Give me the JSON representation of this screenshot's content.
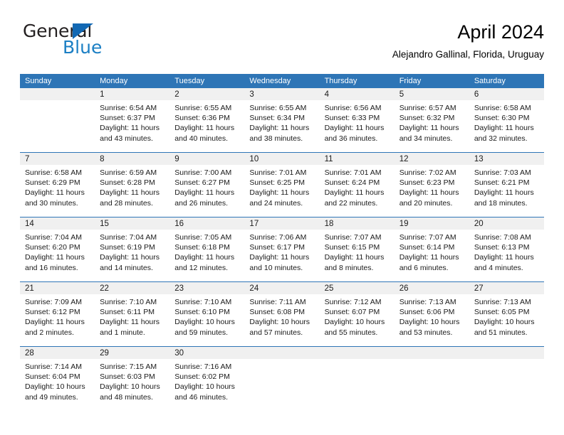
{
  "brand": {
    "name_dark": "General",
    "name_blue": "Blue",
    "triangle_color": "#1268b3",
    "blue_color": "#1b7fc4"
  },
  "header": {
    "title": "April 2024",
    "subtitle": "Alejandro Gallinal, Florida, Uruguay"
  },
  "theme": {
    "header_blue": "#2e75b6",
    "day_band_gray": "#f0f0f0",
    "text": "#1a1a1a"
  },
  "weekdays": [
    "Sunday",
    "Monday",
    "Tuesday",
    "Wednesday",
    "Thursday",
    "Friday",
    "Saturday"
  ],
  "weeks": [
    [
      {
        "day": "",
        "sunrise": "",
        "sunset": "",
        "daylight1": "",
        "daylight2": ""
      },
      {
        "day": "1",
        "sunrise": "Sunrise: 6:54 AM",
        "sunset": "Sunset: 6:37 PM",
        "daylight1": "Daylight: 11 hours",
        "daylight2": "and 43 minutes."
      },
      {
        "day": "2",
        "sunrise": "Sunrise: 6:55 AM",
        "sunset": "Sunset: 6:36 PM",
        "daylight1": "Daylight: 11 hours",
        "daylight2": "and 40 minutes."
      },
      {
        "day": "3",
        "sunrise": "Sunrise: 6:55 AM",
        "sunset": "Sunset: 6:34 PM",
        "daylight1": "Daylight: 11 hours",
        "daylight2": "and 38 minutes."
      },
      {
        "day": "4",
        "sunrise": "Sunrise: 6:56 AM",
        "sunset": "Sunset: 6:33 PM",
        "daylight1": "Daylight: 11 hours",
        "daylight2": "and 36 minutes."
      },
      {
        "day": "5",
        "sunrise": "Sunrise: 6:57 AM",
        "sunset": "Sunset: 6:32 PM",
        "daylight1": "Daylight: 11 hours",
        "daylight2": "and 34 minutes."
      },
      {
        "day": "6",
        "sunrise": "Sunrise: 6:58 AM",
        "sunset": "Sunset: 6:30 PM",
        "daylight1": "Daylight: 11 hours",
        "daylight2": "and 32 minutes."
      }
    ],
    [
      {
        "day": "7",
        "sunrise": "Sunrise: 6:58 AM",
        "sunset": "Sunset: 6:29 PM",
        "daylight1": "Daylight: 11 hours",
        "daylight2": "and 30 minutes."
      },
      {
        "day": "8",
        "sunrise": "Sunrise: 6:59 AM",
        "sunset": "Sunset: 6:28 PM",
        "daylight1": "Daylight: 11 hours",
        "daylight2": "and 28 minutes."
      },
      {
        "day": "9",
        "sunrise": "Sunrise: 7:00 AM",
        "sunset": "Sunset: 6:27 PM",
        "daylight1": "Daylight: 11 hours",
        "daylight2": "and 26 minutes."
      },
      {
        "day": "10",
        "sunrise": "Sunrise: 7:01 AM",
        "sunset": "Sunset: 6:25 PM",
        "daylight1": "Daylight: 11 hours",
        "daylight2": "and 24 minutes."
      },
      {
        "day": "11",
        "sunrise": "Sunrise: 7:01 AM",
        "sunset": "Sunset: 6:24 PM",
        "daylight1": "Daylight: 11 hours",
        "daylight2": "and 22 minutes."
      },
      {
        "day": "12",
        "sunrise": "Sunrise: 7:02 AM",
        "sunset": "Sunset: 6:23 PM",
        "daylight1": "Daylight: 11 hours",
        "daylight2": "and 20 minutes."
      },
      {
        "day": "13",
        "sunrise": "Sunrise: 7:03 AM",
        "sunset": "Sunset: 6:21 PM",
        "daylight1": "Daylight: 11 hours",
        "daylight2": "and 18 minutes."
      }
    ],
    [
      {
        "day": "14",
        "sunrise": "Sunrise: 7:04 AM",
        "sunset": "Sunset: 6:20 PM",
        "daylight1": "Daylight: 11 hours",
        "daylight2": "and 16 minutes."
      },
      {
        "day": "15",
        "sunrise": "Sunrise: 7:04 AM",
        "sunset": "Sunset: 6:19 PM",
        "daylight1": "Daylight: 11 hours",
        "daylight2": "and 14 minutes."
      },
      {
        "day": "16",
        "sunrise": "Sunrise: 7:05 AM",
        "sunset": "Sunset: 6:18 PM",
        "daylight1": "Daylight: 11 hours",
        "daylight2": "and 12 minutes."
      },
      {
        "day": "17",
        "sunrise": "Sunrise: 7:06 AM",
        "sunset": "Sunset: 6:17 PM",
        "daylight1": "Daylight: 11 hours",
        "daylight2": "and 10 minutes."
      },
      {
        "day": "18",
        "sunrise": "Sunrise: 7:07 AM",
        "sunset": "Sunset: 6:15 PM",
        "daylight1": "Daylight: 11 hours",
        "daylight2": "and 8 minutes."
      },
      {
        "day": "19",
        "sunrise": "Sunrise: 7:07 AM",
        "sunset": "Sunset: 6:14 PM",
        "daylight1": "Daylight: 11 hours",
        "daylight2": "and 6 minutes."
      },
      {
        "day": "20",
        "sunrise": "Sunrise: 7:08 AM",
        "sunset": "Sunset: 6:13 PM",
        "daylight1": "Daylight: 11 hours",
        "daylight2": "and 4 minutes."
      }
    ],
    [
      {
        "day": "21",
        "sunrise": "Sunrise: 7:09 AM",
        "sunset": "Sunset: 6:12 PM",
        "daylight1": "Daylight: 11 hours",
        "daylight2": "and 2 minutes."
      },
      {
        "day": "22",
        "sunrise": "Sunrise: 7:10 AM",
        "sunset": "Sunset: 6:11 PM",
        "daylight1": "Daylight: 11 hours",
        "daylight2": "and 1 minute."
      },
      {
        "day": "23",
        "sunrise": "Sunrise: 7:10 AM",
        "sunset": "Sunset: 6:10 PM",
        "daylight1": "Daylight: 10 hours",
        "daylight2": "and 59 minutes."
      },
      {
        "day": "24",
        "sunrise": "Sunrise: 7:11 AM",
        "sunset": "Sunset: 6:08 PM",
        "daylight1": "Daylight: 10 hours",
        "daylight2": "and 57 minutes."
      },
      {
        "day": "25",
        "sunrise": "Sunrise: 7:12 AM",
        "sunset": "Sunset: 6:07 PM",
        "daylight1": "Daylight: 10 hours",
        "daylight2": "and 55 minutes."
      },
      {
        "day": "26",
        "sunrise": "Sunrise: 7:13 AM",
        "sunset": "Sunset: 6:06 PM",
        "daylight1": "Daylight: 10 hours",
        "daylight2": "and 53 minutes."
      },
      {
        "day": "27",
        "sunrise": "Sunrise: 7:13 AM",
        "sunset": "Sunset: 6:05 PM",
        "daylight1": "Daylight: 10 hours",
        "daylight2": "and 51 minutes."
      }
    ],
    [
      {
        "day": "28",
        "sunrise": "Sunrise: 7:14 AM",
        "sunset": "Sunset: 6:04 PM",
        "daylight1": "Daylight: 10 hours",
        "daylight2": "and 49 minutes."
      },
      {
        "day": "29",
        "sunrise": "Sunrise: 7:15 AM",
        "sunset": "Sunset: 6:03 PM",
        "daylight1": "Daylight: 10 hours",
        "daylight2": "and 48 minutes."
      },
      {
        "day": "30",
        "sunrise": "Sunrise: 7:16 AM",
        "sunset": "Sunset: 6:02 PM",
        "daylight1": "Daylight: 10 hours",
        "daylight2": "and 46 minutes."
      },
      {
        "day": "",
        "sunrise": "",
        "sunset": "",
        "daylight1": "",
        "daylight2": ""
      },
      {
        "day": "",
        "sunrise": "",
        "sunset": "",
        "daylight1": "",
        "daylight2": ""
      },
      {
        "day": "",
        "sunrise": "",
        "sunset": "",
        "daylight1": "",
        "daylight2": ""
      },
      {
        "day": "",
        "sunrise": "",
        "sunset": "",
        "daylight1": "",
        "daylight2": ""
      }
    ]
  ]
}
